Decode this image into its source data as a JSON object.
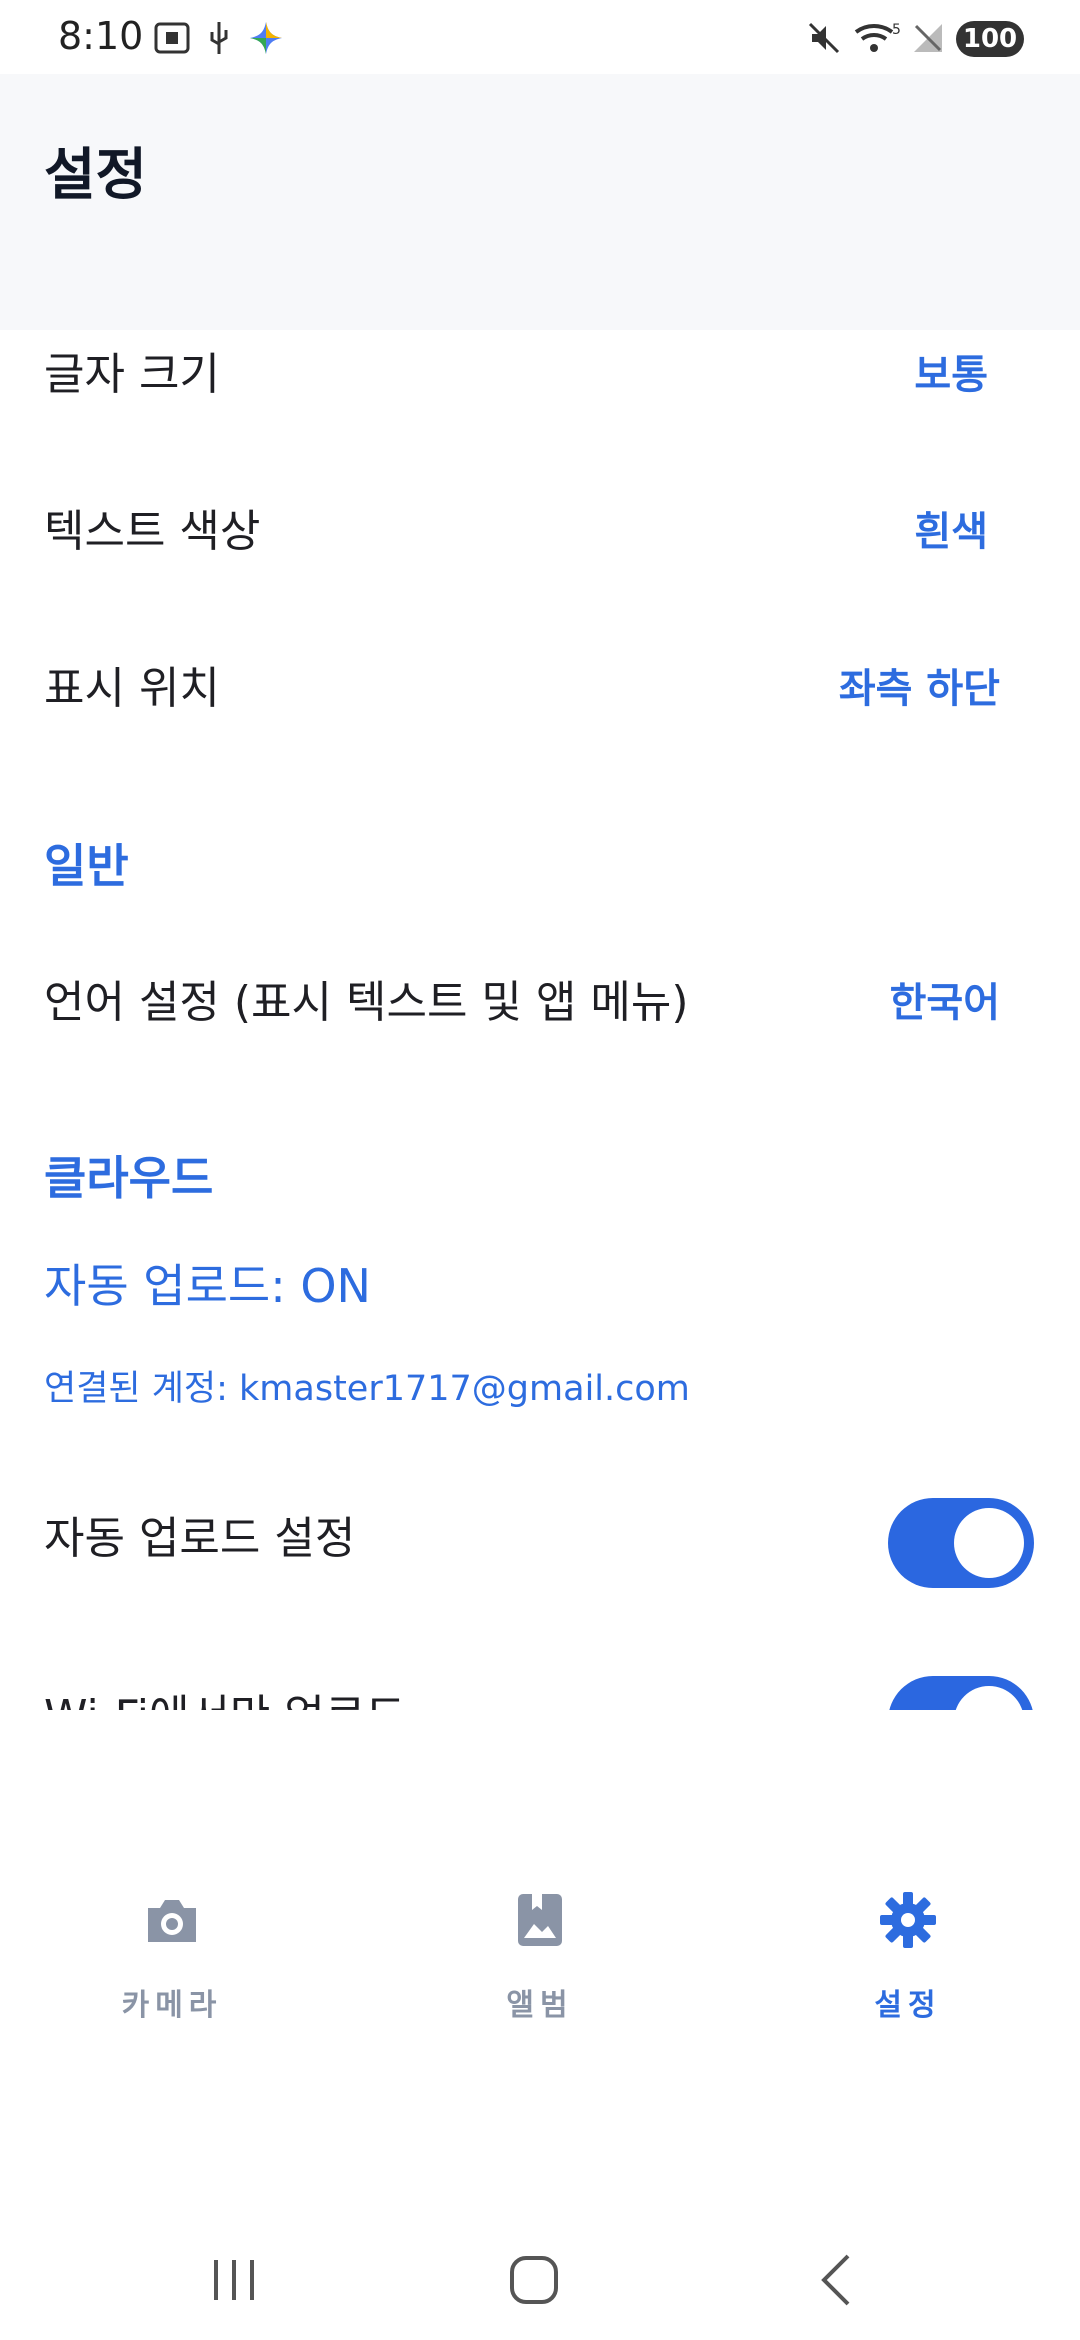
{
  "status_bar": {
    "time": "8:10",
    "battery": "100",
    "signal_label": "5"
  },
  "header": {
    "title": "설정"
  },
  "settings": {
    "text_size": {
      "label": "글자 크기",
      "value": "보통"
    },
    "text_color": {
      "label": "텍스트 색상",
      "value": "흰색"
    },
    "position": {
      "label": "표시 위치",
      "value": "좌측 하단"
    }
  },
  "general": {
    "header": "일반",
    "language": {
      "label": "언어 설정 (표시 텍스트 및 앱 메뉴)",
      "value": "한국어"
    }
  },
  "cloud": {
    "header": "클라우드",
    "auto_upload_status": "자동 업로드: ON",
    "account": "연결된 계정: kmaster1717@gmail.com",
    "auto_upload_setting": {
      "label": "자동 업로드 설정",
      "enabled": true
    },
    "wifi_upload": {
      "label": "Wi-Fi에서만 업로드",
      "enabled": true
    }
  },
  "bottom_nav": {
    "camera": "카메라",
    "album": "앨범",
    "settings": "설정"
  },
  "colors": {
    "accent": "#2d6cdf",
    "inactive": "#8a94a6",
    "header_bg": "#f7f8fa"
  }
}
